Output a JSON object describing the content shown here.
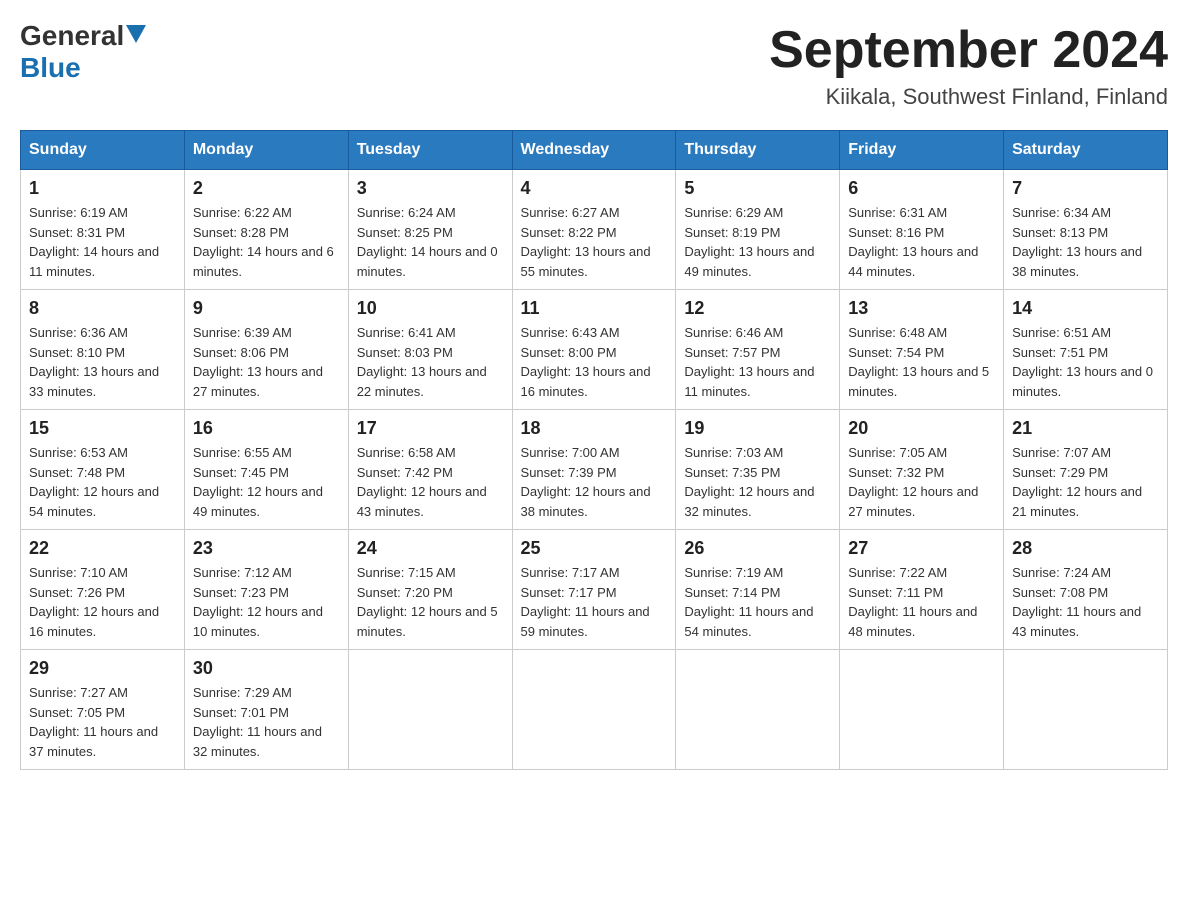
{
  "header": {
    "logo_general": "General",
    "logo_blue": "Blue",
    "month_title": "September 2024",
    "location": "Kiikala, Southwest Finland, Finland"
  },
  "days_of_week": [
    "Sunday",
    "Monday",
    "Tuesday",
    "Wednesday",
    "Thursday",
    "Friday",
    "Saturday"
  ],
  "weeks": [
    [
      {
        "day": "1",
        "sunrise": "Sunrise: 6:19 AM",
        "sunset": "Sunset: 8:31 PM",
        "daylight": "Daylight: 14 hours and 11 minutes."
      },
      {
        "day": "2",
        "sunrise": "Sunrise: 6:22 AM",
        "sunset": "Sunset: 8:28 PM",
        "daylight": "Daylight: 14 hours and 6 minutes."
      },
      {
        "day": "3",
        "sunrise": "Sunrise: 6:24 AM",
        "sunset": "Sunset: 8:25 PM",
        "daylight": "Daylight: 14 hours and 0 minutes."
      },
      {
        "day": "4",
        "sunrise": "Sunrise: 6:27 AM",
        "sunset": "Sunset: 8:22 PM",
        "daylight": "Daylight: 13 hours and 55 minutes."
      },
      {
        "day": "5",
        "sunrise": "Sunrise: 6:29 AM",
        "sunset": "Sunset: 8:19 PM",
        "daylight": "Daylight: 13 hours and 49 minutes."
      },
      {
        "day": "6",
        "sunrise": "Sunrise: 6:31 AM",
        "sunset": "Sunset: 8:16 PM",
        "daylight": "Daylight: 13 hours and 44 minutes."
      },
      {
        "day": "7",
        "sunrise": "Sunrise: 6:34 AM",
        "sunset": "Sunset: 8:13 PM",
        "daylight": "Daylight: 13 hours and 38 minutes."
      }
    ],
    [
      {
        "day": "8",
        "sunrise": "Sunrise: 6:36 AM",
        "sunset": "Sunset: 8:10 PM",
        "daylight": "Daylight: 13 hours and 33 minutes."
      },
      {
        "day": "9",
        "sunrise": "Sunrise: 6:39 AM",
        "sunset": "Sunset: 8:06 PM",
        "daylight": "Daylight: 13 hours and 27 minutes."
      },
      {
        "day": "10",
        "sunrise": "Sunrise: 6:41 AM",
        "sunset": "Sunset: 8:03 PM",
        "daylight": "Daylight: 13 hours and 22 minutes."
      },
      {
        "day": "11",
        "sunrise": "Sunrise: 6:43 AM",
        "sunset": "Sunset: 8:00 PM",
        "daylight": "Daylight: 13 hours and 16 minutes."
      },
      {
        "day": "12",
        "sunrise": "Sunrise: 6:46 AM",
        "sunset": "Sunset: 7:57 PM",
        "daylight": "Daylight: 13 hours and 11 minutes."
      },
      {
        "day": "13",
        "sunrise": "Sunrise: 6:48 AM",
        "sunset": "Sunset: 7:54 PM",
        "daylight": "Daylight: 13 hours and 5 minutes."
      },
      {
        "day": "14",
        "sunrise": "Sunrise: 6:51 AM",
        "sunset": "Sunset: 7:51 PM",
        "daylight": "Daylight: 13 hours and 0 minutes."
      }
    ],
    [
      {
        "day": "15",
        "sunrise": "Sunrise: 6:53 AM",
        "sunset": "Sunset: 7:48 PM",
        "daylight": "Daylight: 12 hours and 54 minutes."
      },
      {
        "day": "16",
        "sunrise": "Sunrise: 6:55 AM",
        "sunset": "Sunset: 7:45 PM",
        "daylight": "Daylight: 12 hours and 49 minutes."
      },
      {
        "day": "17",
        "sunrise": "Sunrise: 6:58 AM",
        "sunset": "Sunset: 7:42 PM",
        "daylight": "Daylight: 12 hours and 43 minutes."
      },
      {
        "day": "18",
        "sunrise": "Sunrise: 7:00 AM",
        "sunset": "Sunset: 7:39 PM",
        "daylight": "Daylight: 12 hours and 38 minutes."
      },
      {
        "day": "19",
        "sunrise": "Sunrise: 7:03 AM",
        "sunset": "Sunset: 7:35 PM",
        "daylight": "Daylight: 12 hours and 32 minutes."
      },
      {
        "day": "20",
        "sunrise": "Sunrise: 7:05 AM",
        "sunset": "Sunset: 7:32 PM",
        "daylight": "Daylight: 12 hours and 27 minutes."
      },
      {
        "day": "21",
        "sunrise": "Sunrise: 7:07 AM",
        "sunset": "Sunset: 7:29 PM",
        "daylight": "Daylight: 12 hours and 21 minutes."
      }
    ],
    [
      {
        "day": "22",
        "sunrise": "Sunrise: 7:10 AM",
        "sunset": "Sunset: 7:26 PM",
        "daylight": "Daylight: 12 hours and 16 minutes."
      },
      {
        "day": "23",
        "sunrise": "Sunrise: 7:12 AM",
        "sunset": "Sunset: 7:23 PM",
        "daylight": "Daylight: 12 hours and 10 minutes."
      },
      {
        "day": "24",
        "sunrise": "Sunrise: 7:15 AM",
        "sunset": "Sunset: 7:20 PM",
        "daylight": "Daylight: 12 hours and 5 minutes."
      },
      {
        "day": "25",
        "sunrise": "Sunrise: 7:17 AM",
        "sunset": "Sunset: 7:17 PM",
        "daylight": "Daylight: 11 hours and 59 minutes."
      },
      {
        "day": "26",
        "sunrise": "Sunrise: 7:19 AM",
        "sunset": "Sunset: 7:14 PM",
        "daylight": "Daylight: 11 hours and 54 minutes."
      },
      {
        "day": "27",
        "sunrise": "Sunrise: 7:22 AM",
        "sunset": "Sunset: 7:11 PM",
        "daylight": "Daylight: 11 hours and 48 minutes."
      },
      {
        "day": "28",
        "sunrise": "Sunrise: 7:24 AM",
        "sunset": "Sunset: 7:08 PM",
        "daylight": "Daylight: 11 hours and 43 minutes."
      }
    ],
    [
      {
        "day": "29",
        "sunrise": "Sunrise: 7:27 AM",
        "sunset": "Sunset: 7:05 PM",
        "daylight": "Daylight: 11 hours and 37 minutes."
      },
      {
        "day": "30",
        "sunrise": "Sunrise: 7:29 AM",
        "sunset": "Sunset: 7:01 PM",
        "daylight": "Daylight: 11 hours and 32 minutes."
      },
      null,
      null,
      null,
      null,
      null
    ]
  ]
}
